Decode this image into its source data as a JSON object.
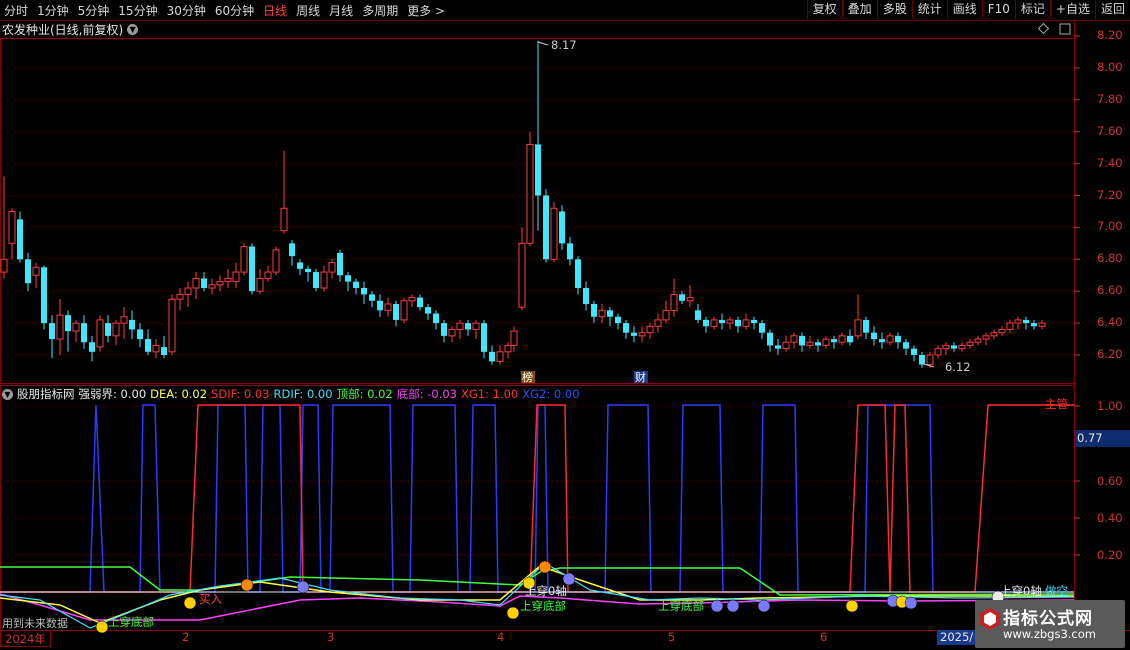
{
  "toolbar": {
    "periods": [
      "分时",
      "1分钟",
      "5分钟",
      "15分钟",
      "30分钟",
      "60分钟",
      "日线",
      "周线",
      "月线",
      "多周期",
      "更多 >"
    ],
    "active_period": "日线",
    "buttons": [
      "复权",
      "叠加",
      "多股",
      "统计",
      "画线",
      "F10",
      "标记",
      "+自选",
      "返回"
    ]
  },
  "main_chart": {
    "title": "农发种业(日线,前复权)",
    "price_axis": [
      "8.20",
      "8.00",
      "7.80",
      "7.60",
      "7.40",
      "7.20",
      "7.00",
      "6.80",
      "6.60",
      "6.40",
      "6.20"
    ],
    "high_marker": "8.17",
    "low_marker": "6.12",
    "event_tags": [
      "榜",
      "财"
    ]
  },
  "indicator": {
    "name": "股朋指标网",
    "values": [
      {
        "label": "强弱界: 0.00",
        "color": "#e8e8e8"
      },
      {
        "label": "DEA: 0.02",
        "color": "#ffff55"
      },
      {
        "label": "SDIF: 0.03",
        "color": "#ff3030"
      },
      {
        "label": "RDIF: 0.00",
        "color": "#40e0ff"
      },
      {
        "label": "顶部: 0.02",
        "color": "#40ff40"
      },
      {
        "label": "底部: -0.03",
        "color": "#ff40ff"
      },
      {
        "label": "XG1: 1.00",
        "color": "#ff3030"
      },
      {
        "label": "XG2: 0.00",
        "color": "#3050ff"
      }
    ],
    "axis": [
      "1.00",
      "0.60",
      "0.40",
      "0.20"
    ],
    "current_value": "0.77",
    "annotations": [
      {
        "text": "上穿底部",
        "color": "#40ff40"
      },
      {
        "text": "上穿底部",
        "color": "#40ff40"
      },
      {
        "text": "上穿底部",
        "color": "#40ff40"
      },
      {
        "text": "上穿0轴",
        "color": "#e8e8e8"
      },
      {
        "text": "上穿0轴",
        "color": "#e8e8e8"
      },
      {
        "text": "买入",
        "color": "#ff4040"
      },
      {
        "text": "做空",
        "color": "#40e0ff"
      },
      {
        "text": "主管",
        "color": "#ff3030"
      }
    ],
    "corner_note": "用到未来数据"
  },
  "time_axis": {
    "year_start": "2024年",
    "months": [
      "2",
      "3",
      "4",
      "5",
      "6"
    ],
    "year_end": "2025/"
  },
  "watermark": {
    "line1": "指标公式网",
    "line2": "www.zbgs3.com"
  }
}
